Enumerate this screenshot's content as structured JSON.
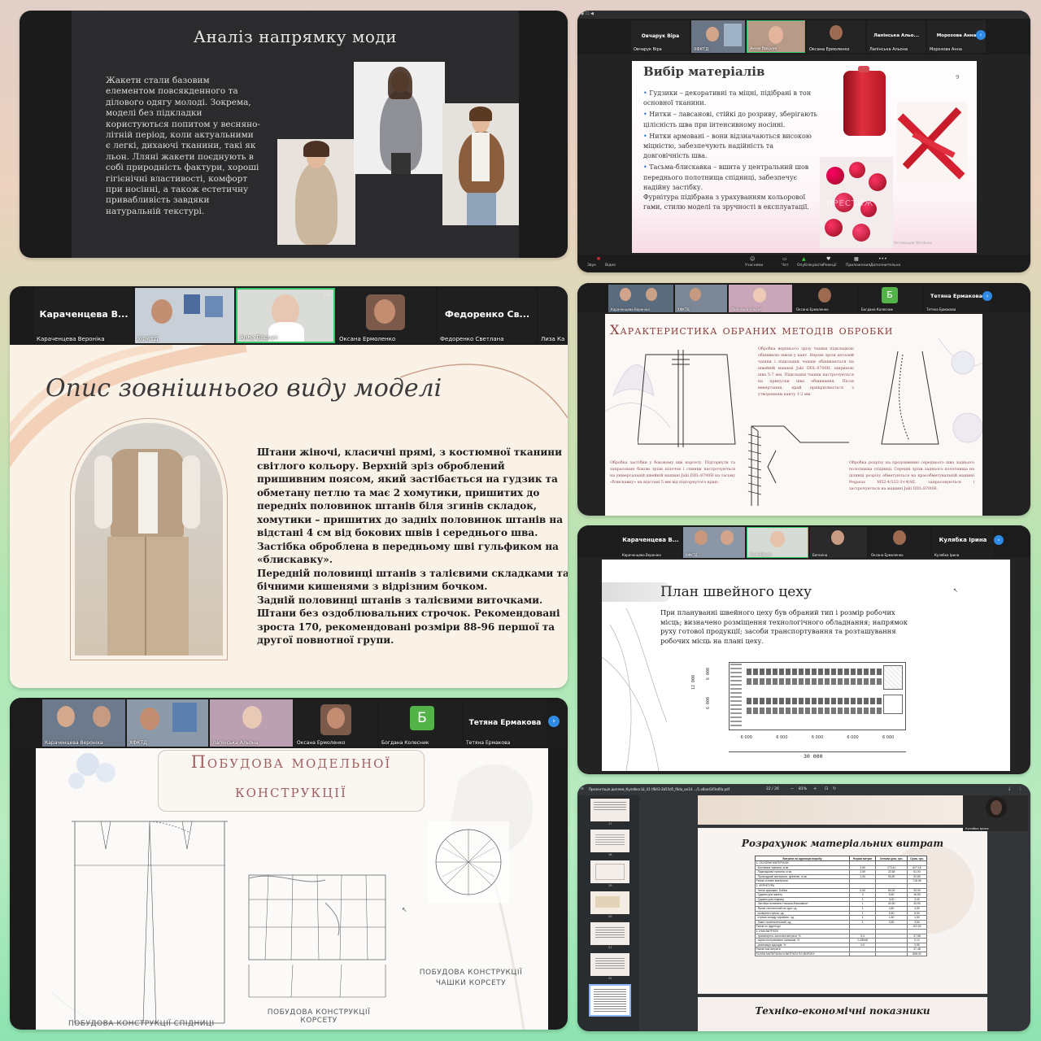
{
  "t1": {
    "title": "Аналіз напрямку моди",
    "body": "Жакети стали базовим елементом повсякденного та ділового одягу молоді. Зокрема, моделі без підкладки користуються попитом у весняно-літній період, коли актуальними є легкі, дихаючі тканини, такі як льон. Лляні жакети поєднують в собі природність фактури, хороші гігієнічні властивості, комфорт при носінні, а також естетичну привабливість завдяки натуральній текстурі."
  },
  "t2": {
    "participants": [
      {
        "big": "Овчарук Віра",
        "small": "Овчарук Віра"
      },
      {
        "big": "",
        "small": "ХФКТД"
      },
      {
        "big": "",
        "small": "Анна Вацьук"
      },
      {
        "big": "",
        "small": "Оксана Ермоленко"
      },
      {
        "big": "Лапінська Альо...",
        "small": "Лапінська Альона"
      },
      {
        "big": "Морозова Анна",
        "small": "Морозова Анна"
      }
    ],
    "title": "Вибір матеріалів",
    "page": "9",
    "bullets": [
      "Гудзики – декоративні та міцні, підібрані в тон основної тканини.",
      "Нитки – лавсанові, стійкі до розриву, зберігають цілісність шва при інтенсивному носінні.",
      "Нитки армовані – вони відзначаються високою міцністю, забезпечують надійність та довговічність шва.",
      "Тасьма-блискавка – вшита у центральний шов переднього полотнища спідниці, забезпечує надійну застібку."
    ],
    "footer_text": "Фурнітура підібрана з урахуванням кольорової гами, стилю моделі та зручності в експлуатації.",
    "watermark": "ПРЕСТИЖ",
    "activation": "Активация Windows",
    "toolbar": [
      "Звук",
      "Відео",
      "Учасники",
      "Чат",
      "Опублікувати",
      "Реакції",
      "Приложения",
      "Дополнительно"
    ]
  },
  "t3": {
    "participants": [
      {
        "big": "Караченцева В...",
        "small": "Караченцева Вероніка"
      },
      {
        "big": "",
        "small": "ХФКТД"
      },
      {
        "big": "",
        "small": "Анна Вацьук"
      },
      {
        "big": "",
        "small": "Оксана Ермоленко"
      },
      {
        "big": "Федоренко Св...",
        "small": "Федоренко Светлана"
      },
      {
        "big": "",
        "small": "Лиза Ка"
      }
    ],
    "title": "Опис зовнішнього виду моделі",
    "desc": "Штани жіночі, класичні прямі, з костюмної тканини світлого кольору. Верхній зріз оброблений пришивним поясом, який застібається на гудзик та обметану петлю та має 2 хомутики, пришитих до передніх половинок штанів біля згинів складок, хомутики – пришитих до задніх половинок штанів на відстані 4 см від бокових швів і середнього шва.\n Застібка оброблена в передньому шві гульфиком на «блискавку».\n Передній половинці штанів з талієвими складками та бічними кишенями з відрізним бочком.\n Задній половинці штанів з талієвими виточками.\n Штани без оздоблювальних строчок. Рекомендовані зроста 170, рекомендовані розміри 88-96 першої та другої повнотної групи."
  },
  "t4": {
    "participants": [
      {
        "big": "",
        "small": "Караченцева Вероніка"
      },
      {
        "big": "",
        "small": "ХФКТД"
      },
      {
        "big": "",
        "small": "Лапінська Альона"
      },
      {
        "big": "",
        "small": "Оксана Ермоленко"
      },
      {
        "big": "Б",
        "small": "Богдана Колесник"
      },
      {
        "big": "Тетяна Ермакова",
        "small": "Тетяна Ермакова"
      }
    ],
    "title": "Характеристика обраних методів обробки",
    "p1": "Обробка верхнього зрізу чашки підкладкою обшивкою швом у кант. Верхні зрізи деталей чашки і підкладки чашки обшиваються на швейній машині Juki DDL-8700H, шириною шва 5-7 мм. Підкладки чашки настрочуються на припуски шва обшивання. Після вивертання, край прикріплюється з утворенням канту 1-2 мм.",
    "p2": "Обробка застібки у боковому шві корсету. Підгорнути та запрасовані бокові зрізи пілочок і спинки настрочуються на універсальній швейній машині Juki DDL-8700H на тасьму «блискавку» на відстані 5 мм від підгорнутого краю.",
    "p3": "Обробка розрізу на продовженні середнього шва заднього полотнища спідниці. Середні зрізи заднього полотнища на ділянці розрізу обметуються на краєобметувальній машині Pegasus M52-4/333-3×4/AE, запрасовуються і застрочуються на машині Juki DDL-8700H."
  },
  "t5": {
    "participants": [
      {
        "big": "Караченцева В...",
        "small": "Караченцева Вероніка"
      },
      {
        "big": "",
        "small": "ХФКТД"
      },
      {
        "big": "",
        "small": "Анна Вацьук"
      },
      {
        "big": "",
        "small": "Евгеніна"
      },
      {
        "big": "",
        "small": "Оксана Ермоленко"
      },
      {
        "big": "Кулябка Ірина",
        "small": "Кулябка Ірина"
      }
    ],
    "title": "План швейного цеху",
    "desc": "При плануванні швейного цеху був обраний тип і розмір робочих місць; визначено розміщення технологічного обладнання; напрямок руху готової продукції; засоби транспортування та розташування робочих місць на плані цеху.",
    "dim_w": "30 000",
    "dim_h": "12 000",
    "dim_h_a": "6 000",
    "dim_h_b": "6 000",
    "cols": [
      "6 000",
      "6 000",
      "6 000",
      "6 000",
      "6 000"
    ]
  },
  "t6": {
    "filename": "Презентація диплом_Кулябка Ш_41 (f843-2b55d5_f6da_ae14..../1.a8ae43f3e6fa.pdf",
    "page": "22 / 26",
    "zoom": "81%",
    "thumb_labels": [
      "17",
      "18",
      "19",
      "20",
      "21",
      "22"
    ],
    "cam_name": "Кулябка Ірина",
    "title": "Розрахунок матеріальних витрат",
    "next_title": "Техніко-економічні показники",
    "table_head": [
      "Витрати на одиницю виробу",
      "Норми витрат",
      "Оптова ціна, грн.",
      "Сума, грн."
    ],
    "table_rows": [
      [
        "1. ОСНОВНІ МАТЕРІАЛИ",
        "",
        "",
        ""
      ],
      [
        "- Костюмна тканина, м кв.",
        "3,60",
        "173,41",
        "627,16"
      ],
      [
        "- Підкладкова тканина, м кв.",
        "2,69",
        "22,68",
        "61,00"
      ],
      [
        "- Прокладкові матеріали, флізелін, м кв.",
        "1,00",
        "30,80",
        "30,80"
      ],
      [
        "Разом основні матеріали",
        "",
        "",
        "718,96"
      ],
      [
        "2. ФУРНІТУРА",
        "",
        "",
        ""
      ],
      [
        "- Нитки армовані, бобіни",
        "0,50",
        "50,00",
        "25,00"
      ],
      [
        "- Гудзики для жакету",
        "3",
        "5,50",
        "16,50"
      ],
      [
        "- Гудзики для спідниці",
        "1",
        "3,00",
        "3,00"
      ],
      [
        "- Застібка потаємна «тасьма-блискавка»",
        "1",
        "40,50",
        "40,50"
      ],
      [
        "- Ярлик текстильний на одяг, од.",
        "1",
        "4,50",
        "4,50"
      ],
      [
        "- розмірна стрічка, од.",
        "1",
        "5,50",
        "5,50"
      ],
      [
        "- стрічка складу сировини, од.",
        "1",
        "1,60",
        "1,60"
      ],
      [
        "- Пакет поліетиленовий, од.",
        "1",
        "3,50",
        "3,50"
      ],
      [
        "Разом по фурнітурі",
        "",
        "",
        "102,50"
      ],
      [
        "3. ІНШІ ВИТРАТИ",
        "",
        "",
        ""
      ],
      [
        "- транспортно-заготовчі витрати, %",
        "5,4",
        "",
        "37,58"
      ],
      [
        "- оцінка неотримання залишків, %",
        "0,25948",
        "",
        "0,12"
      ],
      [
        "- реалізація відходів, %",
        "0,5",
        "",
        "0,95"
      ],
      [
        "Разом інші витрати",
        "",
        "",
        "37,48"
      ],
      [
        "РАЗОМ МАТЕРІАЛЬНІ ВИТРАТИ ПО ВИРОБУ",
        "",
        "",
        "858,90"
      ]
    ]
  },
  "t7": {
    "participants": [
      {
        "big": "",
        "small": "Караченцева Вероніка"
      },
      {
        "big": "",
        "small": "ХФКТД"
      },
      {
        "big": "",
        "small": "Лапінська Альона"
      },
      {
        "big": "",
        "small": "Оксана Ермоленко"
      },
      {
        "big": "Б",
        "small": "Богдана Колесник"
      },
      {
        "big": "Тетяна Ермакова",
        "small": "Тетяна Ермакова"
      }
    ],
    "title_line1": "Побудова модельної",
    "title_line2": "конструкції",
    "cap_skirt": "ПОБУДОВА КОНСТРУКЦІЇ СПІДНИЦІ",
    "cap_corset": "ПОБУДОВА КОНСТРУКЦІЇ КОРСЕТУ",
    "cap_cup": "ПОБУДОВА КОНСТРУКЦІЇ ЧАШКИ КОРСЕТУ"
  },
  "colors": {
    "zoom_blue": "#2f8ae6",
    "active_border": "#35c46a",
    "needle_red": "#d81e2c",
    "gray_slide": "#2b2b2d"
  }
}
